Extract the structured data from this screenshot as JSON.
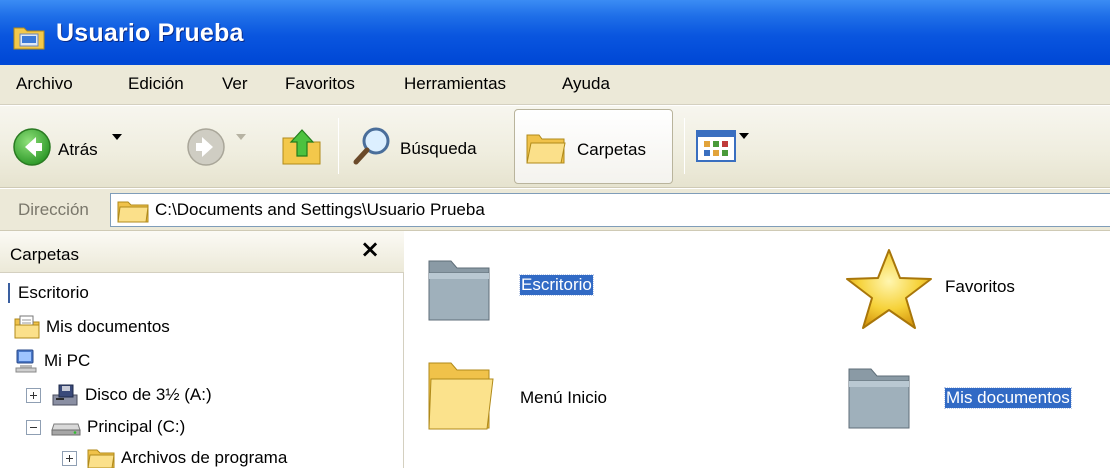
{
  "window": {
    "title": "Usuario Prueba"
  },
  "menu": {
    "items": [
      "Archivo",
      "Edición",
      "Ver",
      "Favoritos",
      "Herramientas",
      "Ayuda"
    ]
  },
  "toolbar": {
    "back_label": "Atrás",
    "search_label": "Búsqueda",
    "folders_label": "Carpetas"
  },
  "address": {
    "label": "Dirección",
    "value": "C:\\Documents and Settings\\Usuario Prueba"
  },
  "folder_pane": {
    "title": "Carpetas",
    "tree": [
      {
        "label": "Escritorio",
        "icon": "desktop-icon"
      },
      {
        "label": "Mis documentos",
        "icon": "my-documents-icon"
      },
      {
        "label": "Mi PC",
        "icon": "my-computer-icon"
      },
      {
        "label": "Disco de 3½ (A:)",
        "icon": "floppy-drive-icon",
        "expander": "plus"
      },
      {
        "label": "Principal (C:)",
        "icon": "hard-drive-icon",
        "expander": "minus"
      },
      {
        "label": "Archivos de programa",
        "icon": "folder-icon",
        "expander": "plus"
      }
    ]
  },
  "content": {
    "items": [
      {
        "label": "Escritorio",
        "icon": "special-folder-icon",
        "selected": true
      },
      {
        "label": "Favoritos",
        "icon": "favorites-star-icon",
        "selected": false
      },
      {
        "label": "Menú Inicio",
        "icon": "folder-icon",
        "selected": false
      },
      {
        "label": "Mis documentos",
        "icon": "special-folder-icon",
        "selected": true
      }
    ]
  },
  "colors": {
    "titlebar": "#0a56df",
    "chrome": "#ece9d8",
    "selection": "#316ac5"
  }
}
